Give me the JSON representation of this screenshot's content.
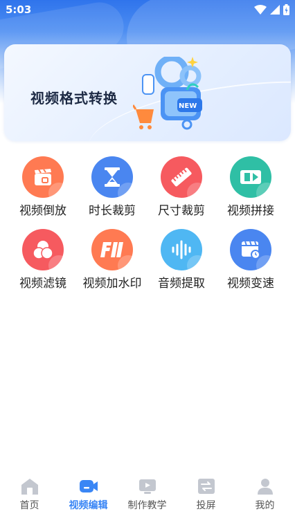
{
  "status_bar": {
    "time": "5:03"
  },
  "banner": {
    "title": "视频格式转换",
    "art_badge": "NEW"
  },
  "tools": [
    {
      "label": "视频倒放",
      "icon": "clapper-icon",
      "color": "#ff7a52"
    },
    {
      "label": "时长裁剪",
      "icon": "hourglass-icon",
      "color": "#4a86f0"
    },
    {
      "label": "尺寸裁剪",
      "icon": "ruler-icon",
      "color": "#f65a5f"
    },
    {
      "label": "视频拼接",
      "icon": "film-join-icon",
      "color": "#2fbfa5"
    },
    {
      "label": "视频滤镜",
      "icon": "filter-circles-icon",
      "color": "#f65a5f"
    },
    {
      "label": "视频加水印",
      "icon": "watermark-icon",
      "color": "#ff7a52"
    },
    {
      "label": "音频提取",
      "icon": "soundwave-icon",
      "color": "#4fb7f3"
    },
    {
      "label": "视频变速",
      "icon": "speed-clock-icon",
      "color": "#4a86f0"
    }
  ],
  "tabbar": {
    "tabs": [
      {
        "label": "首页",
        "icon": "home-icon"
      },
      {
        "label": "视频编辑",
        "icon": "video-camera-icon",
        "active": true
      },
      {
        "label": "制作教学",
        "icon": "tutorial-icon"
      },
      {
        "label": "投屏",
        "icon": "cast-icon"
      },
      {
        "label": "我的",
        "icon": "user-icon"
      }
    ],
    "active_color": "#3a86f5",
    "inactive_color": "#c3c7cf"
  }
}
